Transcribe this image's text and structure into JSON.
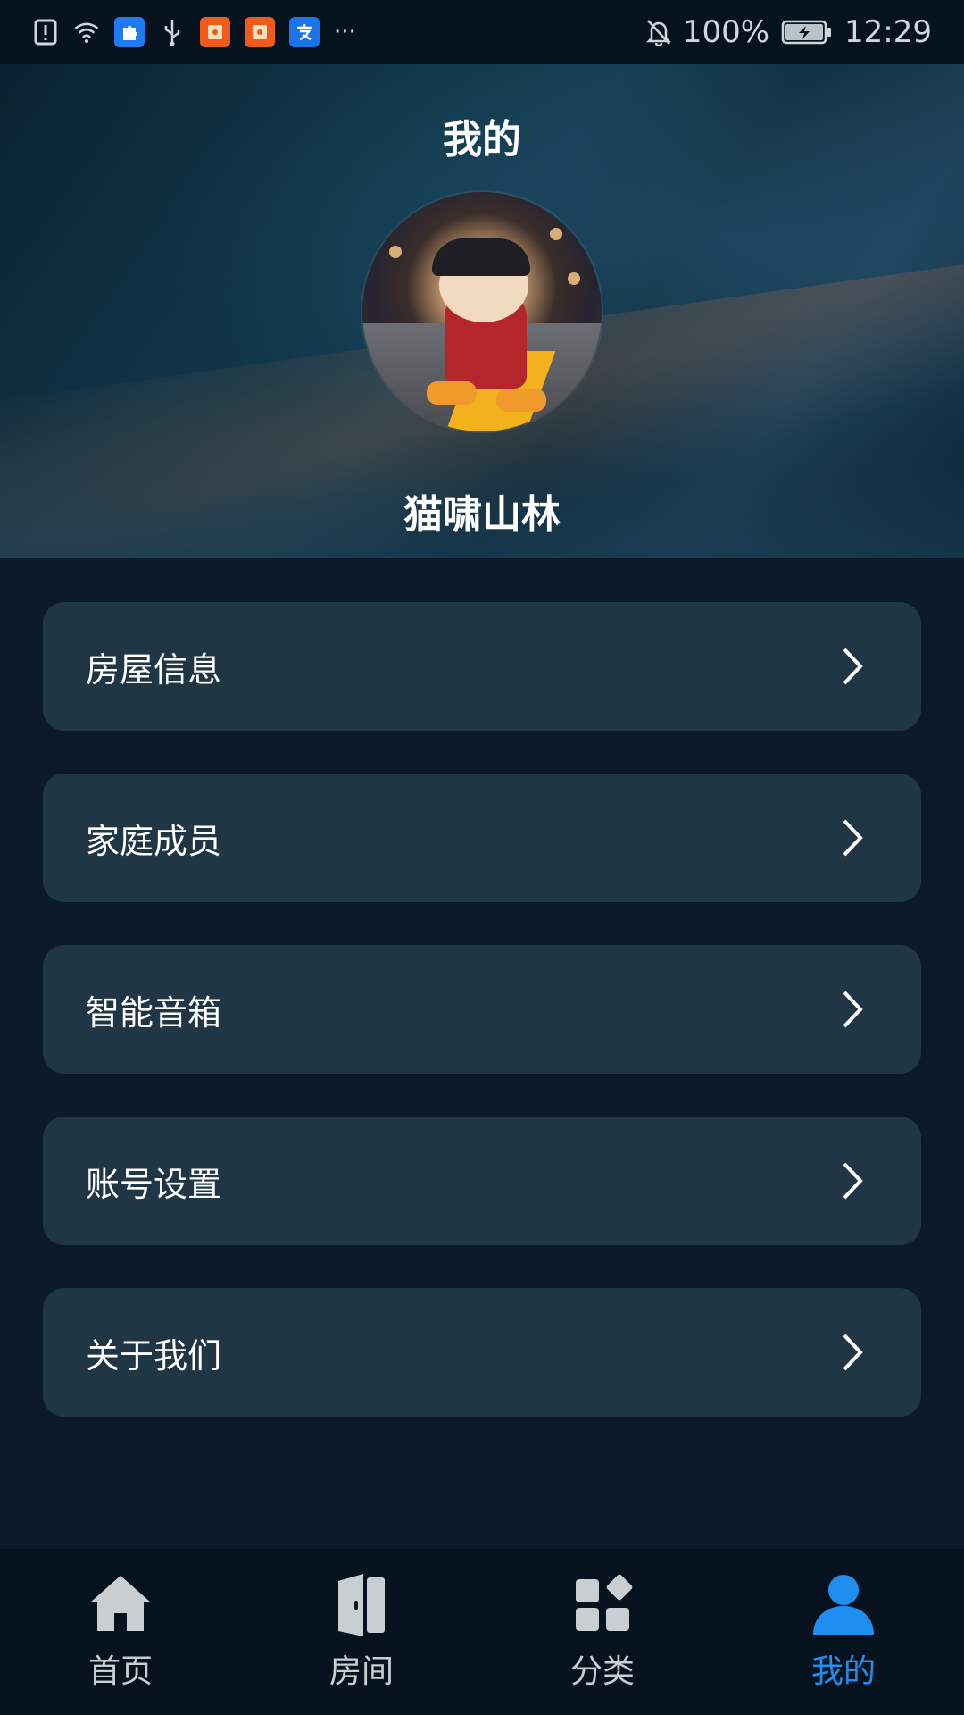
{
  "status_bar": {
    "battery_percent": "100%",
    "time": "12:29",
    "more": "···"
  },
  "header": {
    "title": "我的",
    "username": "猫啸山林"
  },
  "menu": {
    "items": [
      {
        "label": "房屋信息"
      },
      {
        "label": "家庭成员"
      },
      {
        "label": "智能音箱"
      },
      {
        "label": "账号设置"
      },
      {
        "label": "关于我们"
      }
    ]
  },
  "tabbar": {
    "items": [
      {
        "label": "首页",
        "icon": "home-icon"
      },
      {
        "label": "房间",
        "icon": "door-icon"
      },
      {
        "label": "分类",
        "icon": "category-icon"
      },
      {
        "label": "我的",
        "icon": "person-icon"
      }
    ],
    "active_index": 3
  },
  "colors": {
    "background": "#0b1a28",
    "card": "#203645",
    "accent": "#1e8ef0",
    "tab_inactive": "#c9ced3"
  }
}
